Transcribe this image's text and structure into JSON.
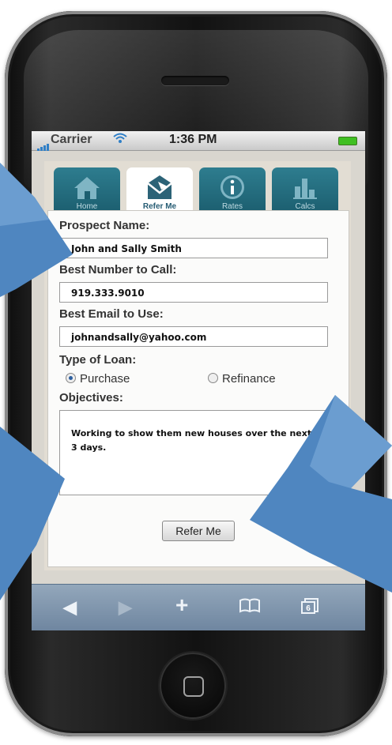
{
  "status": {
    "carrier": "Carrier",
    "time": "1:36 PM"
  },
  "tabs": [
    {
      "label": "Home",
      "icon": "home-icon"
    },
    {
      "label": "Refer Me",
      "icon": "envelope-icon"
    },
    {
      "label": "Rates",
      "icon": "info-icon"
    },
    {
      "label": "Calcs",
      "icon": "bar-chart-icon"
    }
  ],
  "form": {
    "prospect_label": "Prospect Name:",
    "prospect_value": "John and Sally Smith",
    "phone_label": "Best Number to Call:",
    "phone_value": "919.333.9010",
    "email_label": "Best Email to Use:",
    "email_value": "johnandsally@yahoo.com",
    "loan_label": "Type of Loan:",
    "loan_options": [
      "Purchase",
      "Refinance"
    ],
    "loan_selected": "Purchase",
    "objectives_label": "Objectives:",
    "objectives_value": "Working to show them new houses over the next 3 days.",
    "submit_label": "Refer Me"
  },
  "toolbar": {
    "tabs_count": "6"
  },
  "colors": {
    "arrow": "#4f86c0",
    "tab_active_text": "#275d74",
    "tab_bg": "#1f6272"
  }
}
